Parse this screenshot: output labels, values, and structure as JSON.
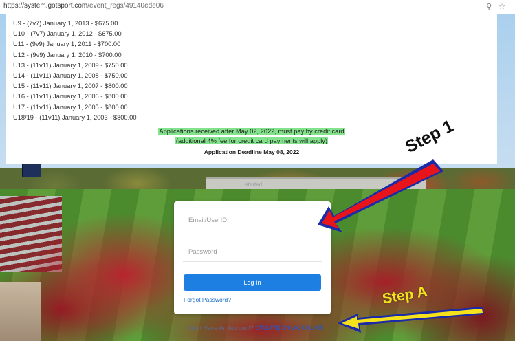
{
  "browser": {
    "url_host": "https://system.gotsport.com",
    "url_path": "/event_regs/49140ede06"
  },
  "fees": [
    "U9 -   (7v7) January 1, 2013 - $675.00",
    "U10 - (7v7) January 1, 2012 - $675.00",
    "U11 - (9v9) January 1, 2011 - $700.00",
    "U12 - (9v9) January 1, 2010 - $700.00",
    "U13 - (11v11) January 1, 2009 - $750.00",
    "U14 - (11v11) January 1, 2008 - $750.00",
    "U15 - (11v11) January 1, 2007 - $800.00",
    "U16 - (11v11) January 1, 2006 - $800.00",
    "U17 - (11v11) January 1, 2005 - $800.00",
    "U18/19 - (11v11) January 1, 2003 - $800.00"
  ],
  "notice": {
    "line1": "Applications received after May 02, 2022, must pay by credit card",
    "line2": "(additional 4% fee for credit card payments will apply)",
    "deadline": "Application Deadline May 08, 2022"
  },
  "background_text": "started.",
  "login": {
    "email_placeholder": "Email/UserID",
    "password_placeholder": "Password",
    "button_label": "Log In",
    "forgot_label": "Forgot Password?",
    "account_prefix": "Don't Have An Account? ",
    "account_link": "CREATE AN ACCOUNT"
  },
  "annotations": {
    "step1": "Step 1",
    "stepA": "Step A",
    "step1_color": "#e8141b",
    "stepA_color": "#f5e21a",
    "arrow_outline": "#1a2aa8"
  }
}
